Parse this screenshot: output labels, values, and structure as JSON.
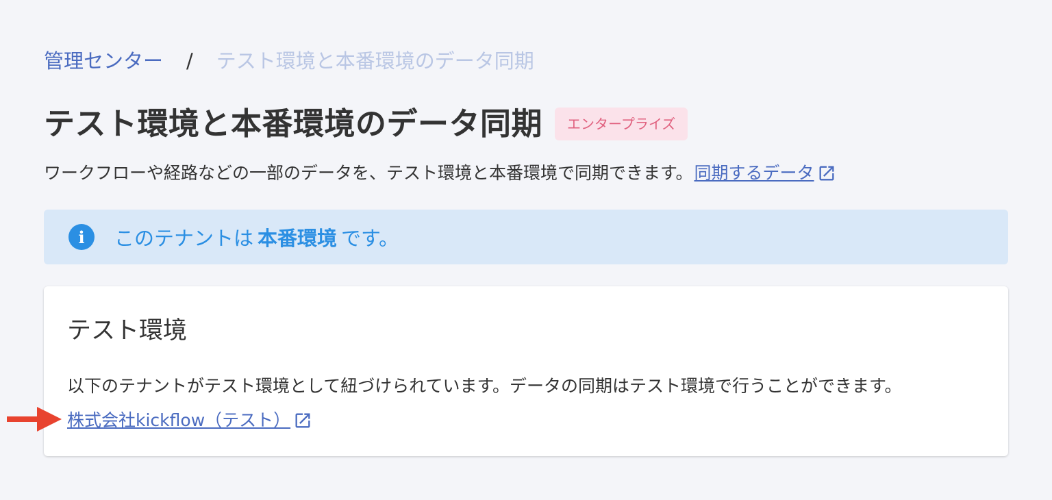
{
  "breadcrumb": {
    "parent": "管理センター",
    "separator": "/",
    "current": "テスト環境と本番環境のデータ同期"
  },
  "header": {
    "title": "テスト環境と本番環境のデータ同期",
    "badge": "エンタープライズ"
  },
  "description": {
    "text": "ワークフローや経路などの一部のデータを、テスト環境と本番環境で同期できます。",
    "link_label": "同期するデータ",
    "link_icon": "external-link-icon"
  },
  "banner": {
    "icon": "info-icon",
    "icon_glyph": "i",
    "prefix": "このテナントは",
    "emphasis": "本番環境",
    "suffix": "です。"
  },
  "card": {
    "title": "テスト環境",
    "description": "以下のテナントがテスト環境として紐づけられています。データの同期はテスト環境で行うことができます。",
    "tenant_link": "株式会社kickflow（テスト）",
    "tenant_link_icon": "external-link-icon"
  },
  "colors": {
    "link": "#4a6bc0",
    "badge_bg": "#fbe2ea",
    "badge_text": "#e0607e",
    "info_bg": "#d9e8f8",
    "info_accent": "#2b8fe3",
    "annotation_arrow": "#e8432f"
  }
}
